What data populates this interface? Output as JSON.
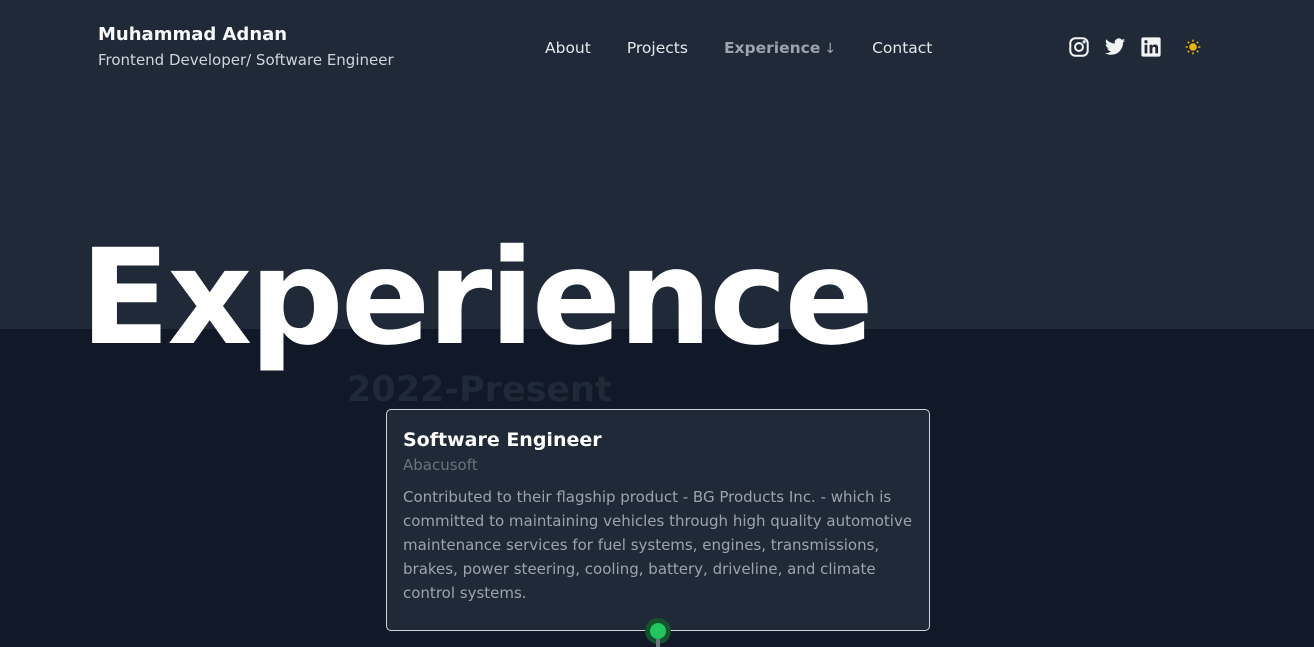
{
  "header": {
    "name": "Muhammad Adnan",
    "role": "Frontend Developer/ Software Engineer",
    "nav": [
      {
        "label": "About"
      },
      {
        "label": "Projects"
      },
      {
        "label": "Experience",
        "indicator": "↓",
        "active": true
      },
      {
        "label": "Contact"
      }
    ],
    "social": [
      "instagram-icon",
      "twitter-icon",
      "linkedin-icon"
    ],
    "theme_icon": "sun-icon"
  },
  "hero": {
    "title": "Experience"
  },
  "experience": {
    "period": "2022-Present",
    "job_title": "Software Engineer",
    "company": "Abacusoft",
    "description": "Contributed to their flagship product - BG Products Inc. - which is committed to maintaining vehicles through high quality automotive maintenance services for fuel systems, engines, transmissions, brakes, power steering, cooling, battery, driveline, and climate control systems."
  },
  "colors": {
    "background": "#111827",
    "header_background": "#1f2937",
    "timeline_dot": "#22c55e",
    "sun": "#eab308"
  }
}
